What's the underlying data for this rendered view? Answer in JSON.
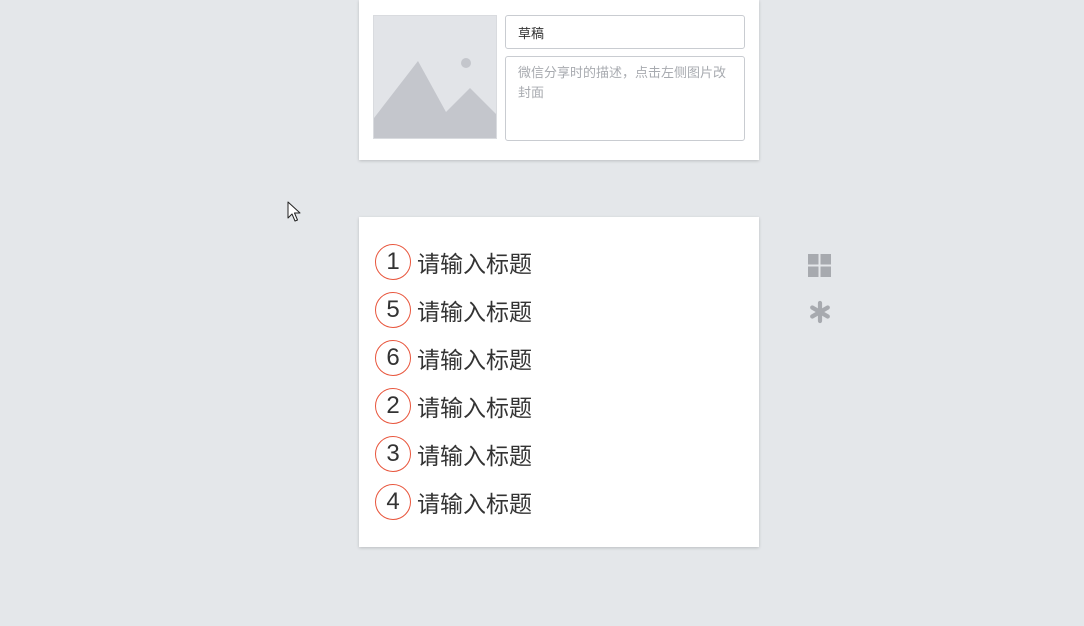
{
  "cover": {
    "image_icon": "image-placeholder-icon",
    "title_value": "草稿",
    "description_placeholder": "微信分享时的描述，点击左侧图片改封面"
  },
  "list": {
    "items": [
      {
        "number": "1",
        "title": "请输入标题"
      },
      {
        "number": "5",
        "title": "请输入标题"
      },
      {
        "number": "6",
        "title": "请输入标题"
      },
      {
        "number": "2",
        "title": "请输入标题"
      },
      {
        "number": "3",
        "title": "请输入标题"
      },
      {
        "number": "4",
        "title": "请输入标题"
      }
    ]
  },
  "side_tools": {
    "grid_icon": "grid-icon",
    "asterisk_icon": "asterisk-icon"
  },
  "colors": {
    "background": "#e4e7ea",
    "accent_circle": "#e8553c",
    "icon_gray": "#a7aaaf"
  }
}
